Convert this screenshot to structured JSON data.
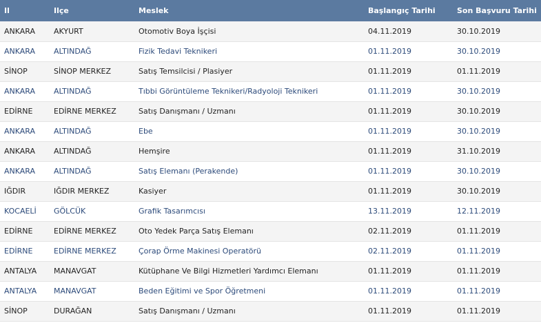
{
  "table": {
    "headers": [
      "Il",
      "Ilçe",
      "Meslek",
      "Başlangıç Tarihi",
      "Son Başvuru Tarihi"
    ],
    "rows": [
      [
        "ANKARA",
        "AKYURT",
        "Otomotiv Boya İşçisi",
        "04.11.2019",
        "30.10.2019"
      ],
      [
        "ANKARA",
        "ALTINDAĞ",
        "Fizik Tedavi Teknikeri",
        "01.11.2019",
        "30.10.2019"
      ],
      [
        "SİNOP",
        "SİNOP MERKEZ",
        "Satış Temsilcisi / Plasiyer",
        "01.11.2019",
        "01.11.2019"
      ],
      [
        "ANKARA",
        "ALTINDAĞ",
        "Tıbbi Görüntüleme Teknikeri/Radyoloji Teknikeri",
        "01.11.2019",
        "30.10.2019"
      ],
      [
        "EDİRNE",
        "EDİRNE MERKEZ",
        "Satış Danışmanı / Uzmanı",
        "01.11.2019",
        "30.10.2019"
      ],
      [
        "ANKARA",
        "ALTINDAĞ",
        "Ebe",
        "01.11.2019",
        "30.10.2019"
      ],
      [
        "ANKARA",
        "ALTINDAĞ",
        "Hemşire",
        "01.11.2019",
        "31.10.2019"
      ],
      [
        "ANKARA",
        "ALTINDAĞ",
        "Satış Elemanı (Perakende)",
        "01.11.2019",
        "30.10.2019"
      ],
      [
        "IĞDIR",
        "IĞDIR MERKEZ",
        "Kasiyer",
        "01.11.2019",
        "30.10.2019"
      ],
      [
        "KOCAELİ",
        "GÖLCÜK",
        "Grafik Tasarımcısı",
        "13.11.2019",
        "12.11.2019"
      ],
      [
        "EDİRNE",
        "EDİRNE MERKEZ",
        "Oto Yedek Parça Satış Elemanı",
        "02.11.2019",
        "01.11.2019"
      ],
      [
        "EDİRNE",
        "EDİRNE MERKEZ",
        "Çorap Örme Makinesi Operatörü",
        "02.11.2019",
        "01.11.2019"
      ],
      [
        "ANTALYA",
        "MANAVGAT",
        "Kütüphane Ve Bilgi Hizmetleri Yardımcı Elemanı",
        "01.11.2019",
        "01.11.2019"
      ],
      [
        "ANTALYA",
        "MANAVGAT",
        "Beden Eğitimi ve Spor Öğretmeni",
        "01.11.2019",
        "01.11.2019"
      ],
      [
        "SİNOP",
        "DURAĞAN",
        "Satış Danışmanı / Uzmanı",
        "01.11.2019",
        "01.11.2019"
      ]
    ]
  }
}
